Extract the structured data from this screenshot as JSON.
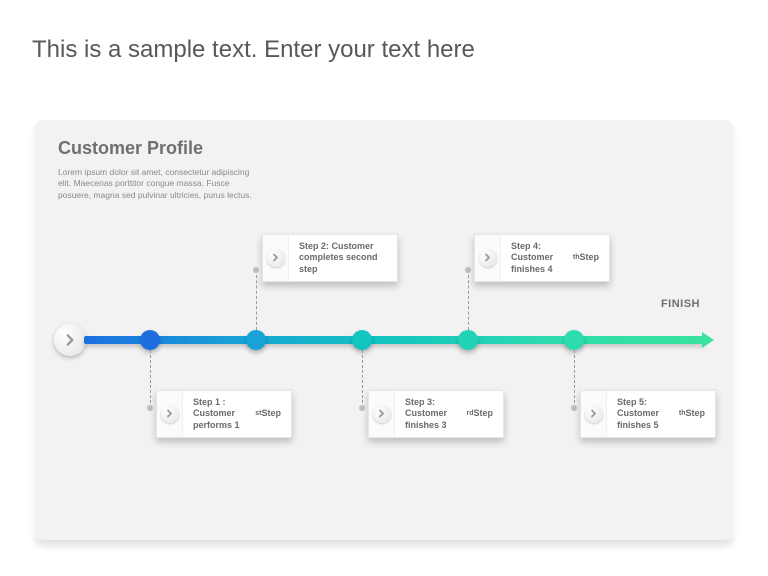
{
  "title": "This is a sample text. Enter your text here",
  "panel": {
    "heading": "Customer Profile",
    "description": "Lorem ipsum dolor sit amet, consectetur adipiscing elit. Maecenas porttitor congue massa. Fusce posuere, magna sed pulvinar ultricies, purus lectus."
  },
  "timeline": {
    "finish_label": "FINISH",
    "nodes": [
      {
        "color": "#1d6fe0"
      },
      {
        "color": "#17a3d6"
      },
      {
        "color": "#13c5c0"
      },
      {
        "color": "#20d3b4"
      },
      {
        "color": "#2ddcae"
      }
    ],
    "steps": [
      {
        "label_html": "Step 1 : Customer performs 1<sup>st</sup> Step",
        "position": "below"
      },
      {
        "label_html": "Step 2: Customer completes second step",
        "position": "above"
      },
      {
        "label_html": "Step 3: Customer finishes 3<sup>rd</sup> Step",
        "position": "below"
      },
      {
        "label_html": "Step 4: Customer finishes 4<sup>th</sup> Step",
        "position": "above"
      },
      {
        "label_html": "Step 5: Customer finishes 5<sup>th</sup> Step",
        "position": "below"
      }
    ]
  }
}
